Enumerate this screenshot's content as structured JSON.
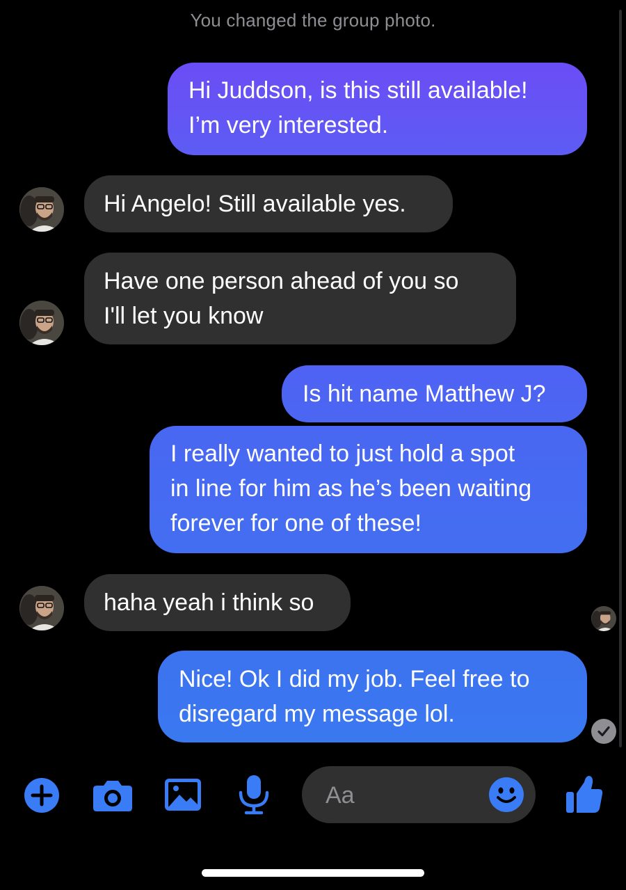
{
  "conversation": {
    "system_note": "You changed the group photo.",
    "messages": [
      {
        "direction": "outgoing",
        "text": "Hi Juddson, is this still available!\nI’m very interested."
      },
      {
        "direction": "incoming",
        "text": "Hi Angelo! Still available yes."
      },
      {
        "direction": "incoming",
        "text": "Have one person ahead of you so\nI'll let you know"
      },
      {
        "direction": "outgoing",
        "text": "Is hit name Matthew J?"
      },
      {
        "direction": "outgoing",
        "text": "I really wanted to just hold a spot\nin line for him as he’s been waiting\nforever for one of these!"
      },
      {
        "direction": "incoming",
        "text": "haha yeah i think so"
      },
      {
        "direction": "outgoing",
        "text": "Nice! Ok I did my job. Feel free to\ndisregard my message lol."
      }
    ]
  },
  "composer": {
    "placeholder": "Aa",
    "icons": [
      "plus-icon",
      "camera-icon",
      "image-icon",
      "microphone-icon",
      "emoji-icon",
      "thumbs-up-icon"
    ]
  },
  "colors": {
    "outgoing_top": "#6a4ff5",
    "outgoing_bottom": "#3c78f0",
    "incoming": "#303030",
    "accent": "#3a7cf5",
    "background": "#000000"
  }
}
